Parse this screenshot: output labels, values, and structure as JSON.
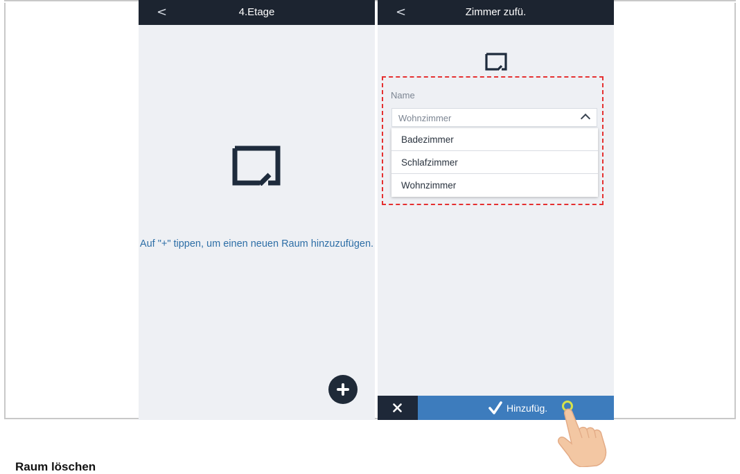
{
  "screen_left": {
    "title": "4.Etage",
    "back_glyph": "<",
    "hint": "Auf \"+\" tippen, um einen neuen Raum hinzuzufügen.",
    "room_icon": "room-icon",
    "add_icon": "plus-icon"
  },
  "screen_right": {
    "title": "Zimmer zufü.",
    "back_glyph": "<",
    "room_icon": "room-icon",
    "name_label": "Name",
    "select_value": "Wohnzimmer",
    "options": [
      "Badezimmer",
      "Schlafzimmer",
      "Wohnzimmer"
    ],
    "cancel_icon": "close-icon",
    "confirm_icon": "checkmark-icon",
    "confirm_label": "Hinzufüg."
  },
  "section_heading": "Raum löschen",
  "colors": {
    "titlebar": "#1c2430",
    "screen_bg": "#eef0f4",
    "hint_text": "#2d6ea6",
    "bottombar": "#3d7cbd",
    "highlight_dash": "#e53030"
  }
}
